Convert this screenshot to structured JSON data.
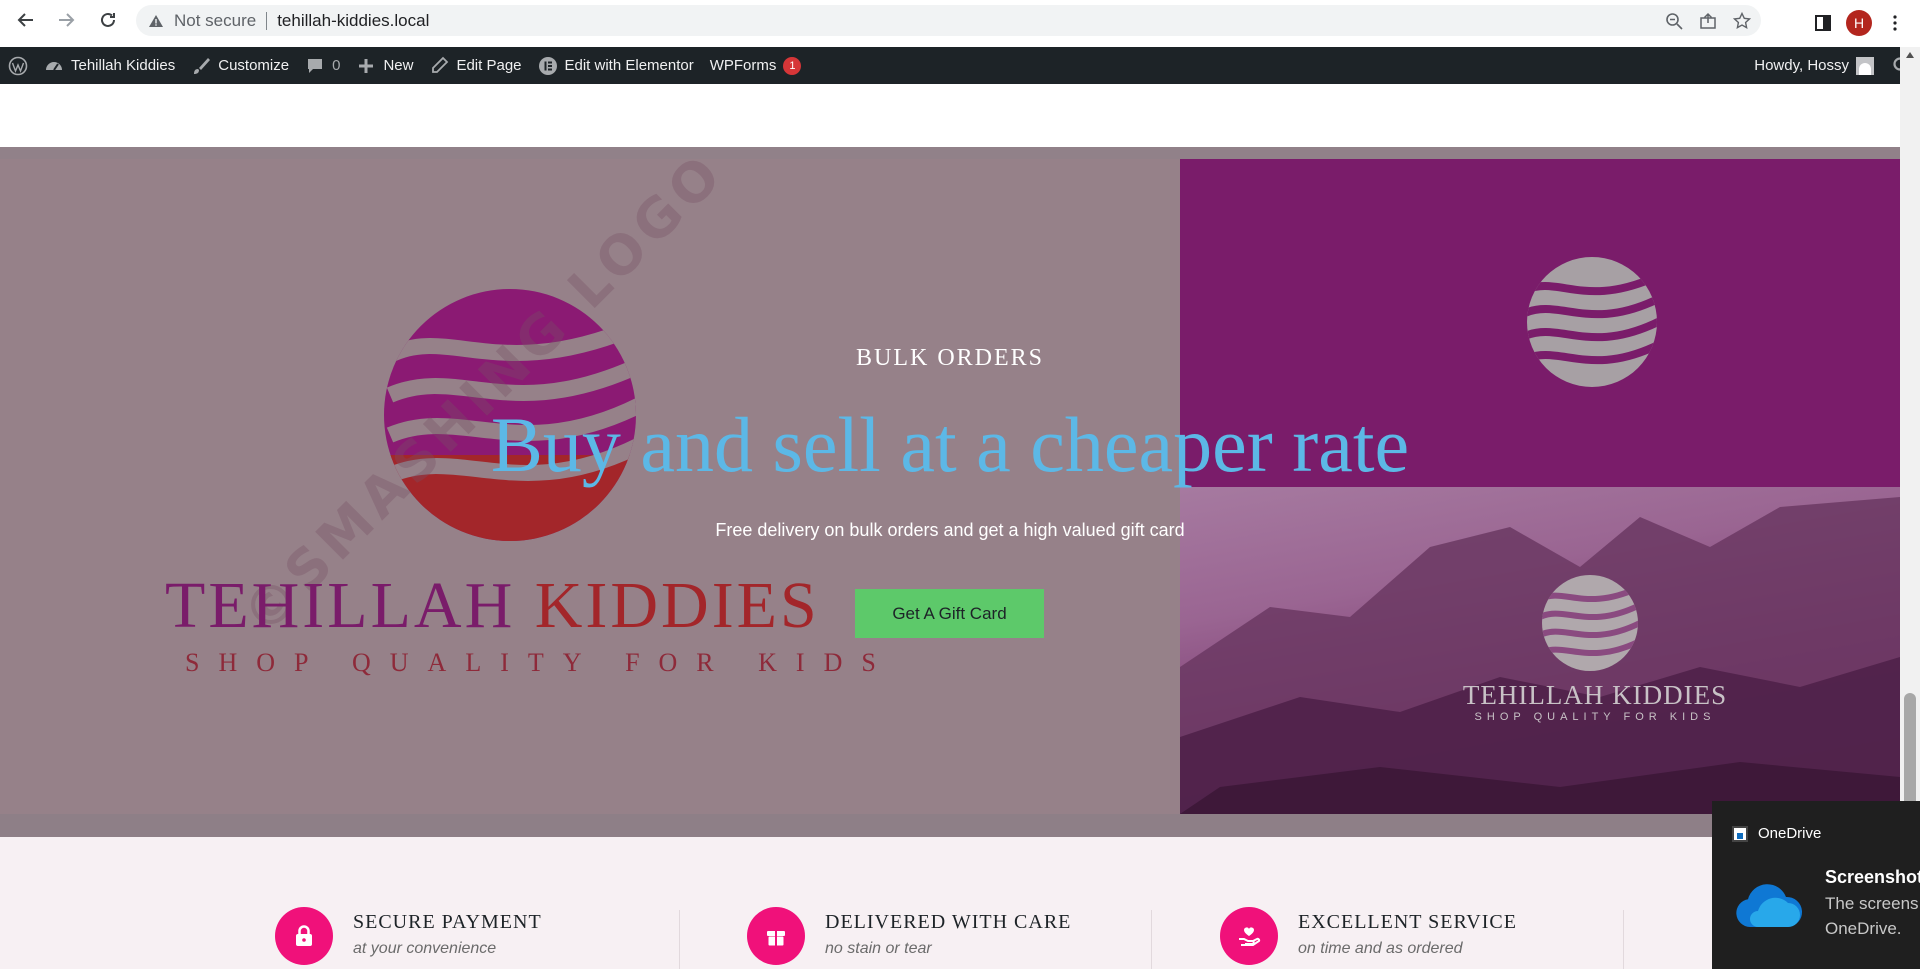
{
  "browser": {
    "security_label": "Not secure",
    "url": "tehillah-kiddies.local",
    "profile_initial": "H"
  },
  "adminbar": {
    "site_name": "Tehillah Kiddies",
    "customize": "Customize",
    "comments_count": "0",
    "new_label": "New",
    "edit_page": "Edit Page",
    "edit_elementor": "Edit with Elementor",
    "wpforms": "WPForms",
    "wpforms_badge": "1",
    "howdy": "Howdy, Hossy"
  },
  "hero": {
    "kicker": "BULK ORDERS",
    "title": "Buy and sell at a cheaper rate",
    "subtitle": "Free delivery on bulk orders and get a high valued gift card",
    "cta": "Get A Gift Card",
    "title_color": "#5cb8e6",
    "cta_color": "#5dc96a",
    "logo_name_part1": "TEHILLAH",
    "logo_name_part2": "KIDDIES",
    "logo_tagline": "SHOP QUALITY FOR KIDS",
    "watermark": "©SMASHING LOGO",
    "small_logo_name": "TEHILLAH KIDDIES",
    "small_logo_tagline": "SHOP QUALITY FOR KIDS"
  },
  "features": [
    {
      "title": "SECURE PAYMENT",
      "subtitle": "at your convenience",
      "icon": "lock-icon"
    },
    {
      "title": "DELIVERED WITH CARE",
      "subtitle": "no stain or tear",
      "icon": "gift-box-icon"
    },
    {
      "title": "EXCELLENT SERVICE",
      "subtitle": "on time and as ordered",
      "icon": "heart-hand-icon"
    }
  ],
  "features_accent": "#f0117a",
  "toast": {
    "app": "OneDrive",
    "title": "Screenshot",
    "body_line1": "The screens",
    "body_line2": "OneDrive."
  }
}
